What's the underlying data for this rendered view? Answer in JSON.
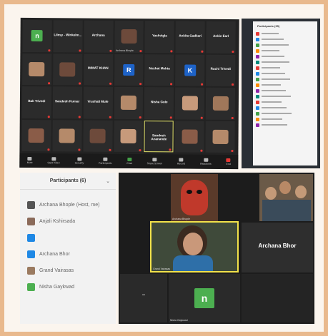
{
  "grid_top": {
    "tiles": [
      {
        "name": "",
        "big": "",
        "color": "#4caf50",
        "letter": "n"
      },
      {
        "name": "",
        "big": "Lilesy - Winkelm...",
        "color": "",
        "letter": ""
      },
      {
        "name": "",
        "big": "Archana",
        "color": "",
        "letter": ""
      },
      {
        "name": "Archana Bhople",
        "big": "",
        "color": "",
        "letter": ""
      },
      {
        "name": "",
        "big": "Yashvigla",
        "color": "",
        "letter": ""
      },
      {
        "name": "",
        "big": "Ankita Gadkari",
        "color": "",
        "letter": ""
      },
      {
        "name": "",
        "big": "Ankie Earl",
        "color": "",
        "letter": ""
      },
      {
        "name": "",
        "big": "",
        "color": "",
        "letter": ""
      },
      {
        "name": "",
        "big": "",
        "color": "",
        "letter": ""
      },
      {
        "name": "",
        "big": "IMMAT KHAN",
        "color": "",
        "letter": ""
      },
      {
        "name": "",
        "big": "",
        "color": "#1e63c8",
        "letter": "R"
      },
      {
        "name": "",
        "big": "Nuzhat Mehta",
        "color": "",
        "letter": ""
      },
      {
        "name": "",
        "big": "",
        "color": "#1e63c8",
        "letter": "K"
      },
      {
        "name": "",
        "big": "Ruchi Trivedi",
        "color": "",
        "letter": ""
      },
      {
        "name": "",
        "big": "Bak Trivedi",
        "color": "",
        "letter": ""
      },
      {
        "name": "",
        "big": "Sandesh Kumar",
        "color": "",
        "letter": ""
      },
      {
        "name": "",
        "big": "Vrushali Mule",
        "color": "",
        "letter": ""
      },
      {
        "name": "",
        "big": "",
        "color": "",
        "letter": ""
      },
      {
        "name": "",
        "big": "Nisha Gole",
        "color": "",
        "letter": ""
      },
      {
        "name": "",
        "big": "",
        "color": "",
        "letter": ""
      },
      {
        "name": "",
        "big": "",
        "color": "",
        "letter": ""
      },
      {
        "name": "",
        "big": "",
        "color": "",
        "letter": ""
      },
      {
        "name": "",
        "big": "",
        "color": "",
        "letter": ""
      },
      {
        "name": "",
        "big": "",
        "color": "",
        "letter": ""
      },
      {
        "name": "",
        "big": "",
        "color": "",
        "letter": ""
      },
      {
        "name": "",
        "big": "Sandesh Ananande",
        "color": "",
        "letter": ""
      },
      {
        "name": "",
        "big": "",
        "color": "",
        "letter": ""
      },
      {
        "name": "",
        "big": "",
        "color": "",
        "letter": ""
      }
    ],
    "toolbar": [
      "Mute",
      "Start Video",
      "Security",
      "Participants",
      "Chat",
      "Share Screen",
      "Record",
      "Reactions",
      "End"
    ]
  },
  "participants_small": {
    "title": "Participants (35)",
    "count_rows": 17
  },
  "participants_panel": {
    "title": "Participants (6)",
    "people": [
      {
        "name": "Archana Bhople (Host, me)",
        "avatar_color": "#555"
      },
      {
        "name": "Anjali Kshirsada",
        "avatar_color": "#8a6a5a"
      },
      {
        "name": "",
        "avatar_color": "#1e88e5"
      },
      {
        "name": "Archana Bhor",
        "avatar_color": "#1e88e5"
      },
      {
        "name": "Grand Vairasas",
        "avatar_color": "#9a7a60"
      },
      {
        "name": "Nisha Gaykwad",
        "avatar_color": "#4caf50"
      }
    ]
  },
  "grid_bottom": {
    "tile_mask_name": "Archana Bhople",
    "tile_group_name": "",
    "tile_video_name": "Grand Vairasas",
    "tile_text_name": "Archana Bhor",
    "tile_dash": "--",
    "tile_n_letter": "n",
    "tile_n_name": "Nisha Gaykwad"
  }
}
